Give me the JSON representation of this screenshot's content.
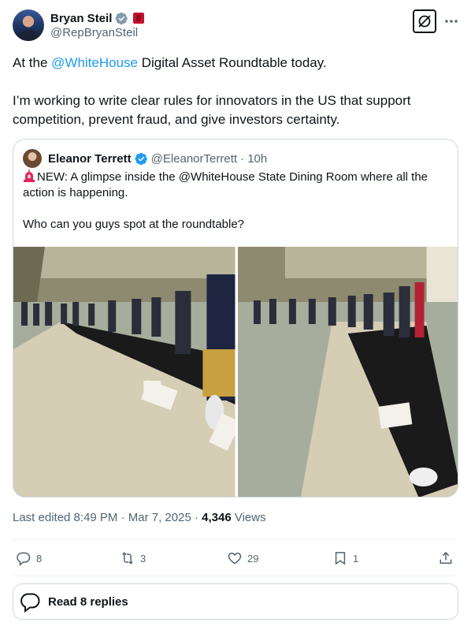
{
  "author": {
    "display_name": "Bryan Steil",
    "handle": "@RepBryanSteil"
  },
  "tweet": {
    "text_before_mention": "At the ",
    "mention": "@WhiteHouse",
    "text_after_mention": " Digital Asset Roundtable today.",
    "paragraph2": "I’m working to write clear rules for innovators in the US that support competition, prevent fraud, and give investors certainty."
  },
  "quote": {
    "display_name": "Eleanor Terrett",
    "handle": "@EleanorTerrett",
    "time": "· 10h",
    "line1": "NEW: A glimpse inside the @WhiteHouse State Dining Room where all the action is happening.",
    "line2": "Who can you guys spot at the roundtable?"
  },
  "meta": {
    "edited": "Last edited 8:49 PM · Mar 7, 2025 · ",
    "views_count": "4,346",
    "views_label": " Views"
  },
  "actions": {
    "replies": "8",
    "reposts": "3",
    "likes": "29",
    "bookmarks": "1"
  },
  "read_replies_label": "Read 8 replies",
  "colors": {
    "link": "#1d9bf0",
    "verified_blue": "#1d9bf0",
    "verified_gray": "#829aab",
    "text": "#0f1419",
    "secondary": "#536471",
    "border": "#cfd9de"
  },
  "icons": [
    "verified-gray-badge-icon",
    "flag-icon",
    "grok-icon",
    "more-icon",
    "verified-blue-badge-icon",
    "siren-icon",
    "reply-icon",
    "repost-icon",
    "like-icon",
    "bookmark-icon",
    "share-icon",
    "speech-bubble-icon"
  ]
}
